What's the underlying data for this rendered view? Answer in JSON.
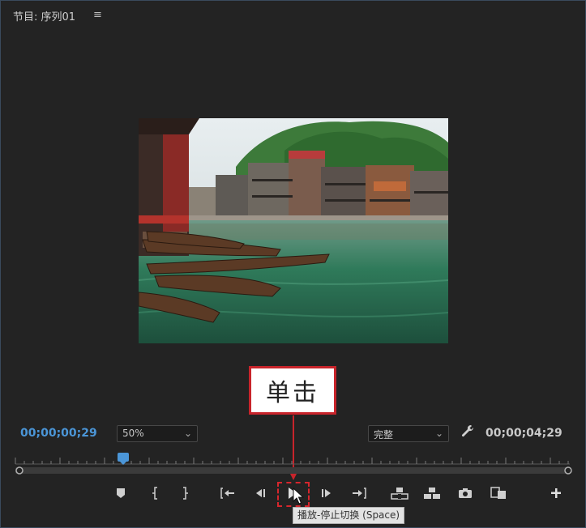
{
  "panel": {
    "title": "节目: 序列01",
    "menu_icon": "≡"
  },
  "annotation": {
    "callout_text": "单击",
    "accent_color": "#c8242b"
  },
  "controls": {
    "current_timecode": "00;00;00;29",
    "duration_timecode": "00;00;04;29",
    "zoom_level": "50%",
    "playback_quality": "完整",
    "playhead_fraction": 0.194
  },
  "transport": [
    {
      "name": "add-marker-icon"
    },
    {
      "name": "mark-in-icon"
    },
    {
      "name": "mark-out-icon"
    },
    {
      "name": "go-to-in-icon"
    },
    {
      "name": "step-back-icon"
    },
    {
      "name": "play-icon"
    },
    {
      "name": "step-forward-icon"
    },
    {
      "name": "go-to-out-icon"
    },
    {
      "name": "lift-icon"
    },
    {
      "name": "extract-icon"
    },
    {
      "name": "camera-icon"
    },
    {
      "name": "compare-view-icon"
    },
    {
      "name": "add-button-icon"
    }
  ],
  "tooltip": {
    "text": "播放-停止切换 (Space)"
  },
  "colors": {
    "timecode_blue": "#4b96d8",
    "panel_bg": "#232323"
  }
}
